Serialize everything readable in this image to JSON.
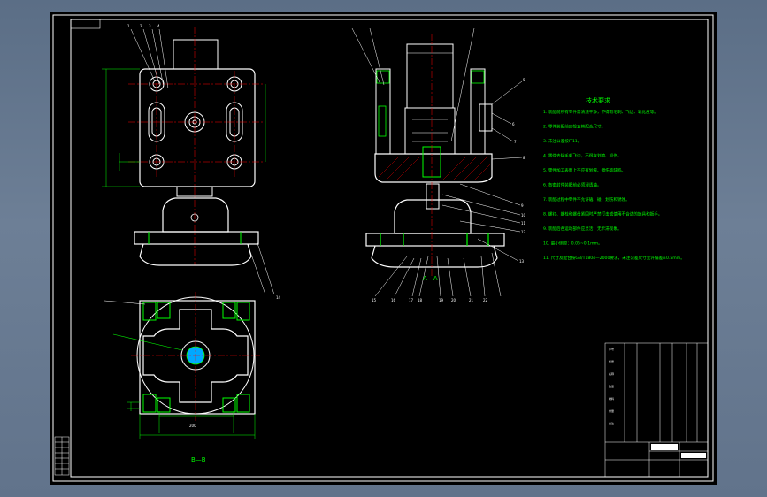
{
  "drawing": {
    "section_aa_label": "A—A",
    "section_bb_label": "B—B",
    "tech_notes_title": "技术要求",
    "tech_notes": [
      "1. 装配前所有零件需清洗干净，不得有毛刺、飞边、氧化皮等。",
      "2. 零件装配前应检查其配合尺寸。",
      "3. 未注公差按IT11。",
      "4. 零件去除毛刺飞边，不得有划痕、损伤。",
      "5. 零件加工表面上不应有划痕、擦伤等缺陷。",
      "6. 各密封件装配前必须浸透油。",
      "7. 装配过程中零件不允许磕、碰、划伤和锈蚀。",
      "8. 螺钉、螺栓和螺母紧固时严禁打击或使用不合适的旋具和扳手。",
      "9. 装配后各运动部件应灵活，无卡滞现象。",
      "10. 最小侧隙：0.05~0.1mm。",
      "11. 尺寸及配合按GB/T1804—2000要求，未注公差尺寸允许偏差±0.5mm。"
    ],
    "dim_label": "200",
    "balloons_top": [
      "1",
      "2",
      "3",
      "4"
    ],
    "balloons_right": [
      "5",
      "6",
      "7",
      "8",
      "9",
      "10",
      "11",
      "12",
      "13",
      "14"
    ],
    "balloons_bottom": [
      "15",
      "16",
      "17",
      "18",
      "19",
      "20",
      "21",
      "22"
    ],
    "title_block": {
      "rows": [
        "序号",
        "代号",
        "名称",
        "数量",
        "材料",
        "重量",
        "备注"
      ]
    }
  }
}
